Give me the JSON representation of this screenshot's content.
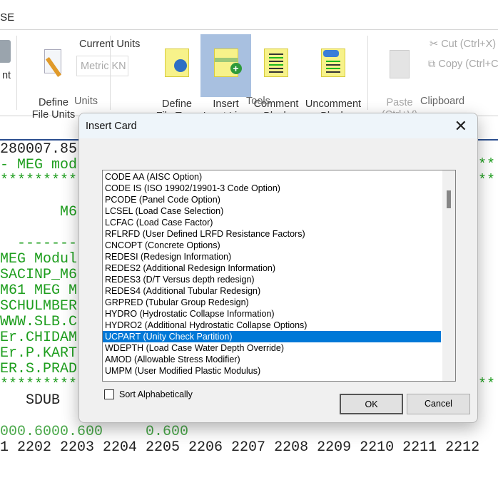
{
  "app": {
    "title": "ISE"
  },
  "ribbon": {
    "print_label": "nt",
    "define_units": "Define\nFile Units",
    "current_units_label": "Current Units",
    "current_units_value": "Metric KN",
    "units_group": "Units",
    "define_file_type": "Define\nFile Type",
    "insert_input_line": "Insert\nInput Line",
    "comment_block": "Comment\nBlock",
    "uncomment_block": "Uncomment\nBlock",
    "tools_group": "Tools",
    "paste": "Paste\n(Ctrl+V)",
    "cut": "Cut (Ctrl+X)",
    "copy": "Copy (Ctrl+C)",
    "clipboard_group": "Clipboard"
  },
  "editor": {
    "lines": [
      {
        "text": "280007.85",
        "c": "k"
      },
      {
        "text": "- MEG mod",
        "c": "g",
        "right": "**"
      },
      {
        "text": "*********",
        "c": "g",
        "right": "**"
      },
      {
        "text": "",
        "c": "g"
      },
      {
        "text": "       M6",
        "c": "g"
      },
      {
        "text": "",
        "c": "g"
      },
      {
        "text": "  -------",
        "c": "g"
      },
      {
        "text": "MEG Modul",
        "c": "g"
      },
      {
        "text": "SACINP_M6",
        "c": "g"
      },
      {
        "text": "M61 MEG M",
        "c": "g"
      },
      {
        "text": "SCHULMBER",
        "c": "g"
      },
      {
        "text": "WWW.SLB.C",
        "c": "g"
      },
      {
        "text": "Er.CHIDAM",
        "c": "g"
      },
      {
        "text": "Er.P.KART",
        "c": "g"
      },
      {
        "text": "ER.S.PRAD",
        "c": "g"
      },
      {
        "text": "*********",
        "c": "g",
        "right": "**"
      },
      {
        "text": "   SDUB",
        "c": "k"
      },
      {
        "text": "",
        "c": "k"
      },
      {
        "text": "000.6000.600     0.600",
        "c": "lg"
      },
      {
        "text": "1 2202 2203 2204 2205 2206 2207 2208 2209 2210 2211 2212",
        "c": "k"
      }
    ]
  },
  "dialog": {
    "title": "Insert Card",
    "items": [
      "CODE AA (AISC Option)",
      "CODE IS (ISO 19902/19901-3 Code Option)",
      "PCODE (Panel Code Option)",
      "LCSEL (Load Case Selection)",
      "LCFAC (Load Case Factor)",
      "RFLRFD (User Defined LRFD Resistance Factors)",
      "CNCOPT (Concrete Options)",
      "REDESI (Redesign Information)",
      "REDES2 (Additional Redesign Information)",
      "REDES3 (D/T Versus depth redesign)",
      "REDES4 (Additional Tubular Redesign)",
      "GRPRED (Tubular Group Redesign)",
      "HYDRO (Hydrostatic Collapse Information)",
      "HYDRO2 (Additional Hydrostatic Collapse Options)",
      "UCPART (Unity Check Partition)",
      "WDEPTH (Load Case Water Depth Override)",
      "AMOD (Allowable Stress Modifier)",
      "UMPM (User Modified Plastic Modulus)"
    ],
    "selected_index": 14,
    "sort_label": "Sort Alphabetically",
    "sort_checked": false,
    "ok": "OK",
    "cancel": "Cancel"
  }
}
